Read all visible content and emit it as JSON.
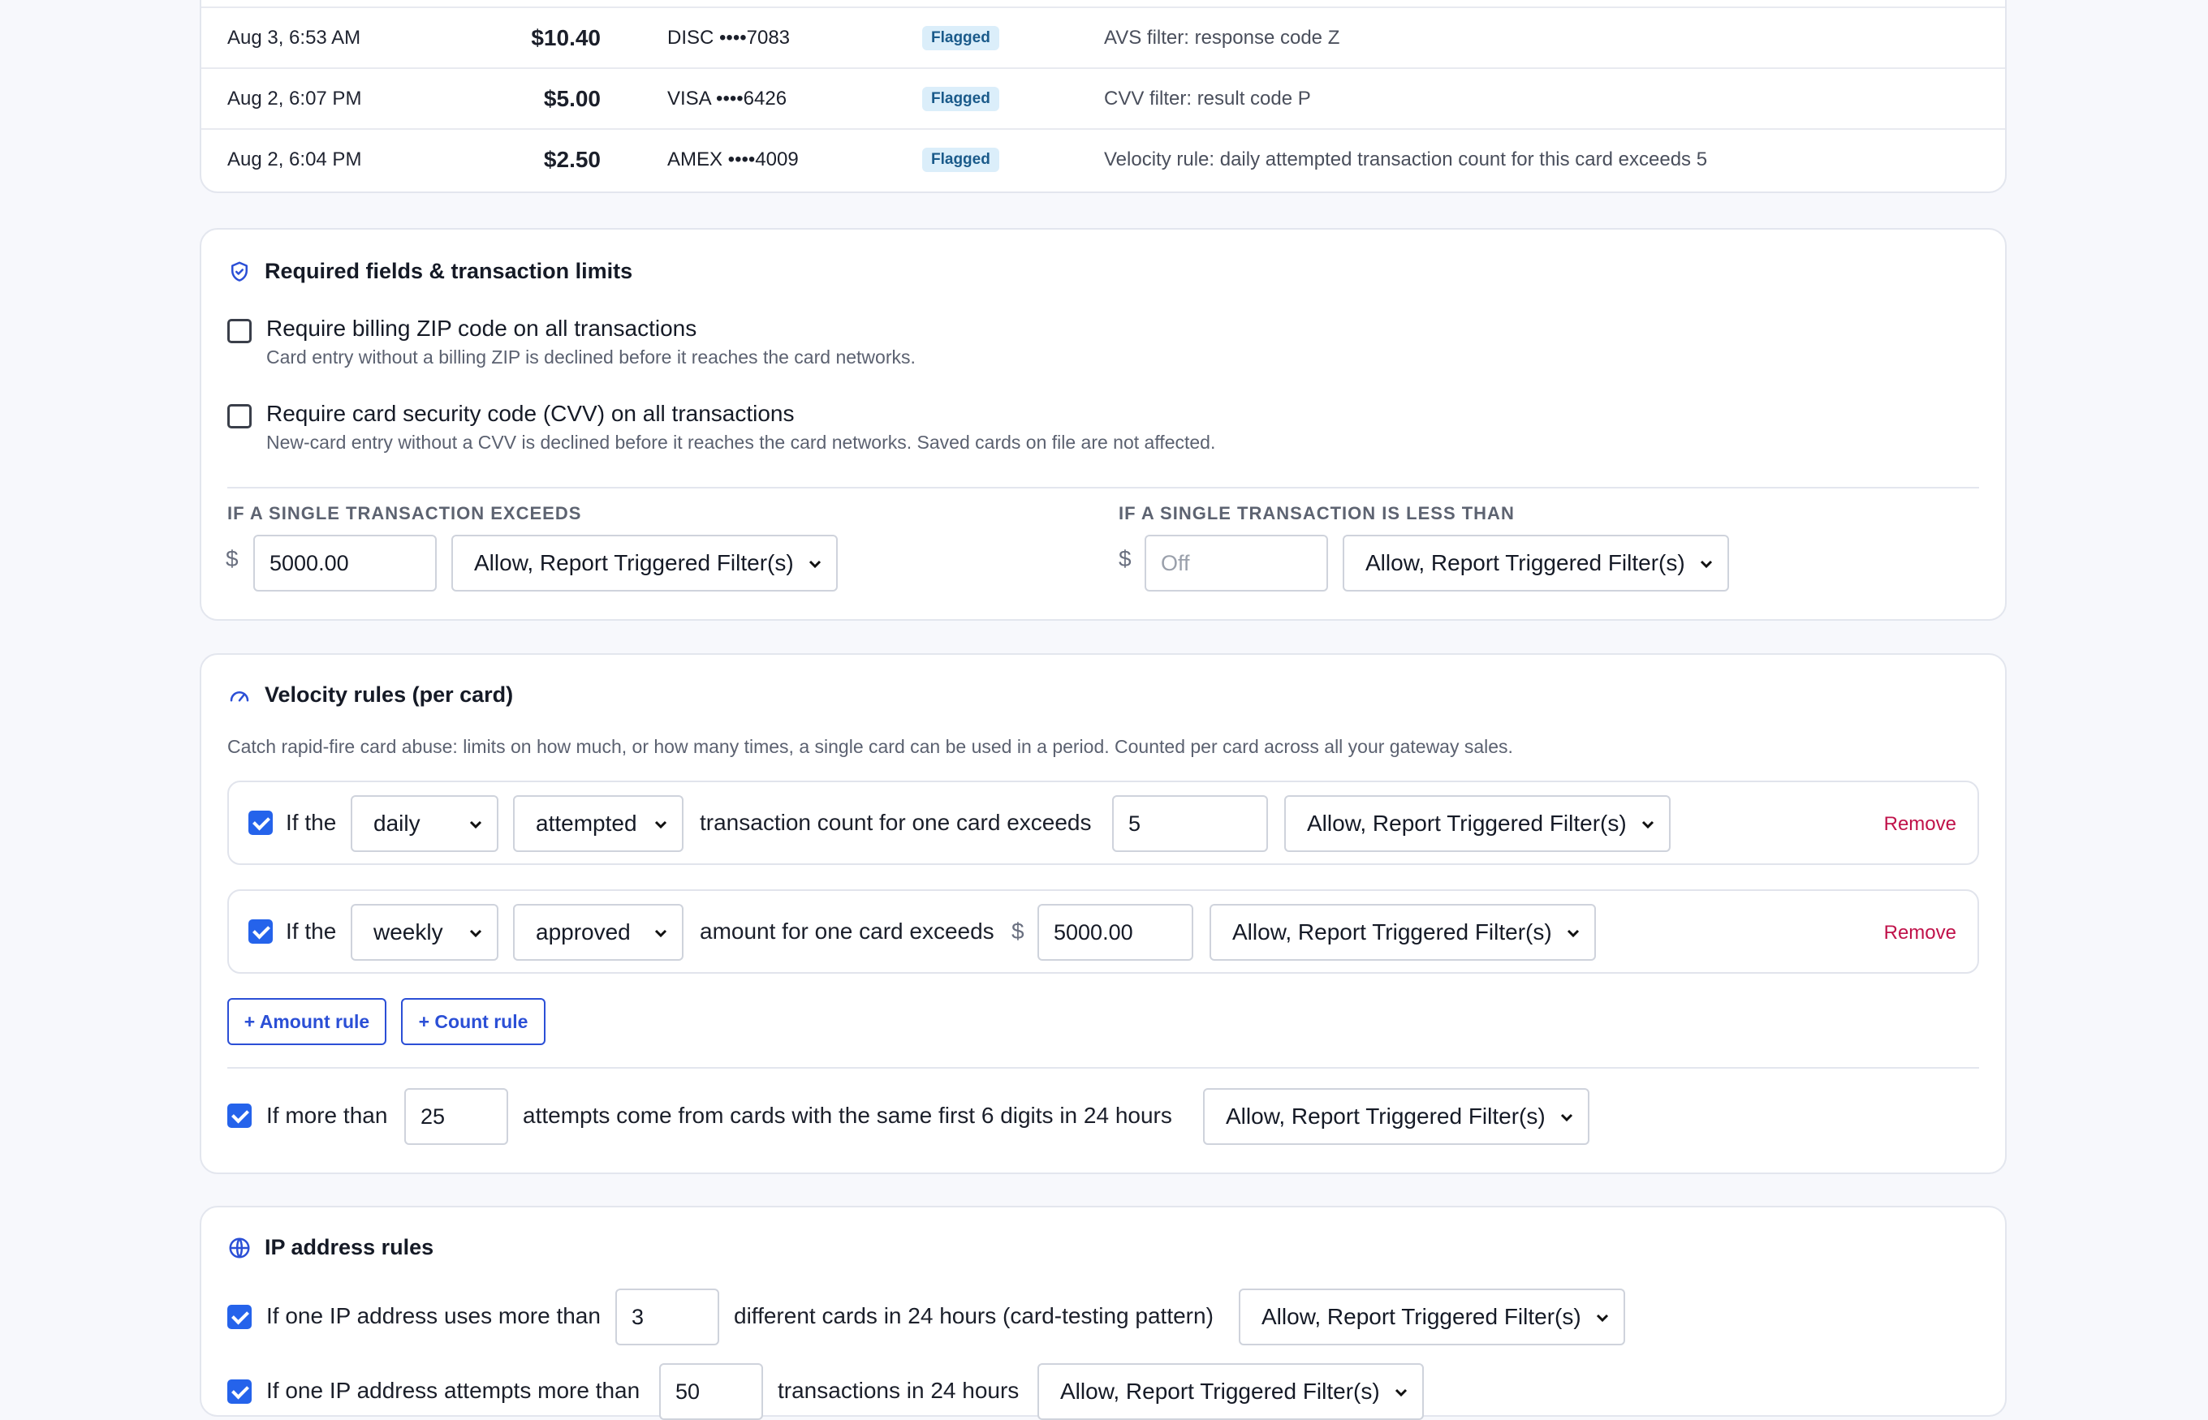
{
  "transactions": [
    {
      "date": "Aug 3, 6:53 AM",
      "amount": "$10.40",
      "card": "DISC ••••7083",
      "status": "Flagged",
      "reason": "AVS filter: response code Z"
    },
    {
      "date": "Aug 2, 6:07 PM",
      "amount": "$5.00",
      "card": "VISA ••••6426",
      "status": "Flagged",
      "reason": "CVV filter: result code P"
    },
    {
      "date": "Aug 2, 6:04 PM",
      "amount": "$2.50",
      "card": "AMEX ••••4009",
      "status": "Flagged",
      "reason": "Velocity rule: daily attempted transaction count for this card exceeds 5"
    }
  ],
  "required": {
    "title": "Required fields & transaction limits",
    "zip_label": "Require billing ZIP code on all transactions",
    "zip_sub": "Card entry without a billing ZIP is declined before it reaches the card networks.",
    "zip_checked": false,
    "cvv_label": "Require card security code (CVV) on all transactions",
    "cvv_sub": "New-card entry without a CVV is declined before it reaches the card networks. Saved cards on file are not affected.",
    "cvv_checked": false,
    "exceeds_heading": "IF A SINGLE TRANSACTION EXCEEDS",
    "exceeds_currency": "$",
    "exceeds_value": "5000.00",
    "exceeds_action": "Allow, Report Triggered Filter(s)",
    "less_heading": "IF A SINGLE TRANSACTION IS LESS THAN",
    "less_currency": "$",
    "less_placeholder": "Off",
    "less_action": "Allow, Report Triggered Filter(s)"
  },
  "velocity": {
    "title": "Velocity rules (per card)",
    "description": "Catch rapid-fire card abuse: limits on how much, or how many times, a single card can be used in a period. Counted per card across all your gateway sales.",
    "rules": [
      {
        "checked": true,
        "prefix": "If the",
        "period": "daily",
        "kind": "attempted",
        "text": "transaction count for one card exceeds",
        "currency": "",
        "value": "5",
        "action": "Allow, Report Triggered Filter(s)",
        "remove": "Remove"
      },
      {
        "checked": true,
        "prefix": "If the",
        "period": "weekly",
        "kind": "approved",
        "text": "amount for one card exceeds",
        "currency": "$",
        "value": "5000.00",
        "action": "Allow, Report Triggered Filter(s)",
        "remove": "Remove"
      }
    ],
    "add_amount": "+ Amount rule",
    "add_count": "+ Count rule",
    "bin_prefix": "If more than",
    "bin_value": "25",
    "bin_text": "attempts come from cards with the same first 6 digits in 24 hours",
    "bin_action": "Allow, Report Triggered Filter(s)"
  },
  "ip": {
    "title": "IP address rules",
    "rule1_prefix": "If one IP address uses more than",
    "rule1_value": "3",
    "rule1_text": "different cards in 24 hours (card-testing pattern)",
    "rule1_action": "Allow, Report Triggered Filter(s)",
    "rule2_prefix": "If one IP address attempts more than",
    "rule2_value": "50",
    "rule2_text": "transactions in 24 hours",
    "rule2_action": "Allow, Report Triggered Filter(s)"
  },
  "colors": {
    "accent": "#2563eb",
    "remove": "#c0124a",
    "badge_bg": "#dbeefa",
    "badge_text": "#1a5a8a"
  }
}
